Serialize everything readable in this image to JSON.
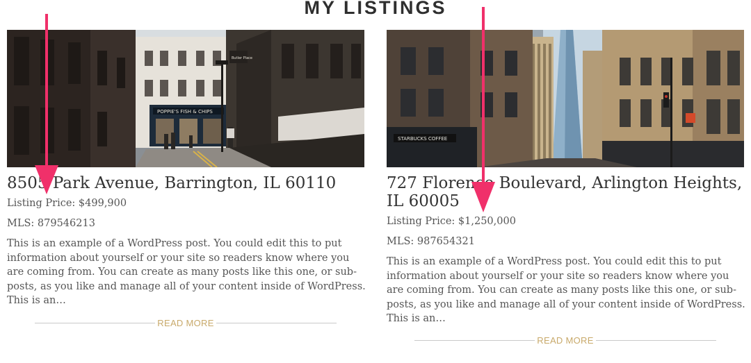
{
  "page": {
    "title": "MY LISTINGS"
  },
  "listings": [
    {
      "address": "8505 Park Avenue, Barrington, IL 60110",
      "price": "Listing Price: $499,900",
      "mls": "MLS: 879546213",
      "excerpt": "This is an example of a WordPress post. You could edit this to put information about yourself or your site so readers know where you are coming from. You can create as many posts like this one, or sub-posts, as you like and manage all of your content inside of WordPress. This is an…",
      "read_more": "READ MORE",
      "photo_signs": [
        "POPPIE'S FISH & CHIPS",
        "Butler Place"
      ]
    },
    {
      "address": "727 Florence Boulevard, Arlington Heights, IL 60005",
      "price": "Listing Price: $1,250,000",
      "mls": "MLS: 987654321",
      "excerpt": "This is an example of a WordPress post. You could edit this to put information about yourself or your site so readers know where you are coming from. You can create as many posts like this one, or sub-posts, as you like and manage all of your content inside of WordPress. This is an…",
      "read_more": "READ MORE",
      "photo_signs": [
        "STARBUCKS COFFEE"
      ]
    }
  ],
  "colors": {
    "accent": "#c8a96a",
    "arrow": "#f0306a",
    "title": "#2f2f2f"
  }
}
